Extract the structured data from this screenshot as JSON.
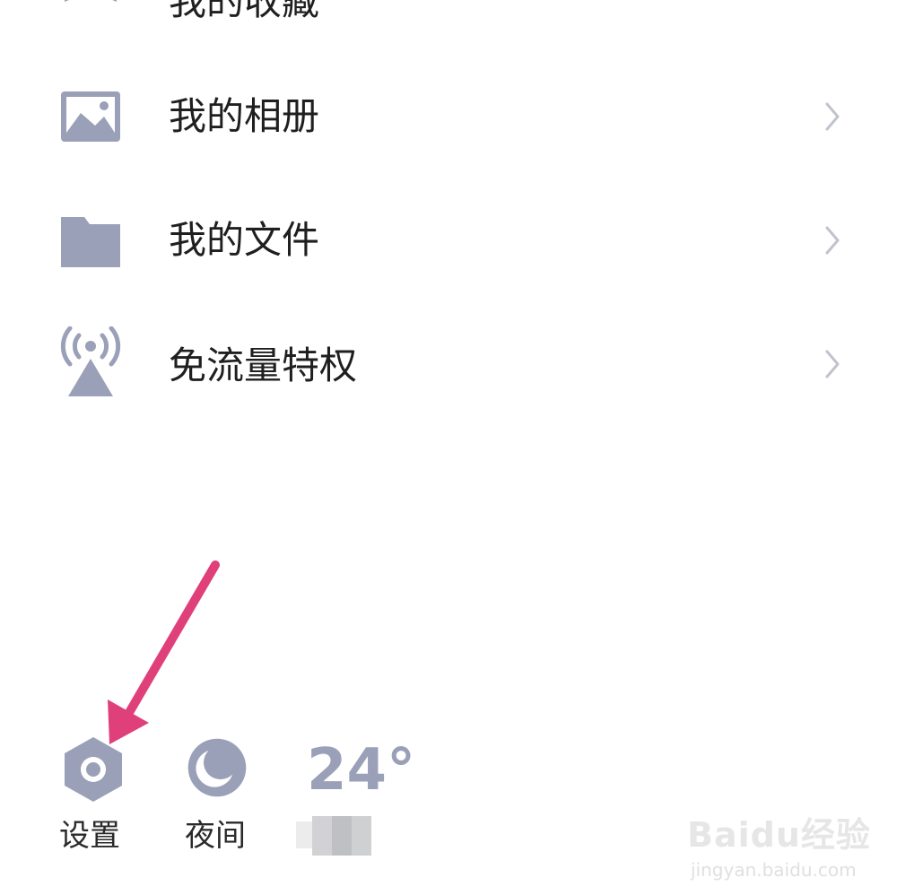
{
  "menu": {
    "items": [
      {
        "label": "我的收藏",
        "icon": "bookmark-icon"
      },
      {
        "label": "我的相册",
        "icon": "image-icon"
      },
      {
        "label": "我的文件",
        "icon": "folder-icon"
      },
      {
        "label": "免流量特权",
        "icon": "signal-tower-icon"
      }
    ]
  },
  "bottom_bar": {
    "settings_label": "设置",
    "night_label": "夜间",
    "temperature": "24°"
  },
  "watermark": {
    "logo": "Baidu经验",
    "url": "jingyan.baidu.com"
  },
  "colors": {
    "icon": "#9aa0b8",
    "chevron": "#c0c3cc",
    "arrow": "#e0407a"
  }
}
